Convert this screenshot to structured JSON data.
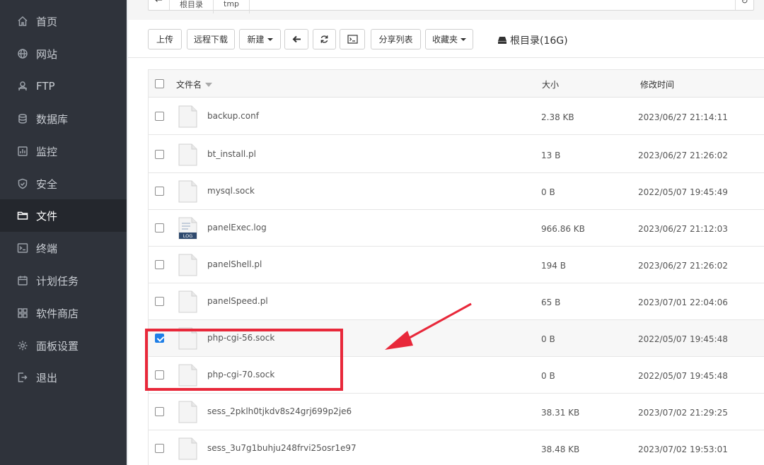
{
  "sidebar": {
    "items": [
      {
        "label": "首页",
        "icon": "home-icon",
        "active": false
      },
      {
        "label": "网站",
        "icon": "globe-icon",
        "active": false
      },
      {
        "label": "FTP",
        "icon": "ftp-icon",
        "active": false
      },
      {
        "label": "数据库",
        "icon": "database-icon",
        "active": false
      },
      {
        "label": "监控",
        "icon": "monitor-icon",
        "active": false
      },
      {
        "label": "安全",
        "icon": "shield-icon",
        "active": false
      },
      {
        "label": "文件",
        "icon": "folder-icon",
        "active": true
      },
      {
        "label": "终端",
        "icon": "terminal-icon",
        "active": false
      },
      {
        "label": "计划任务",
        "icon": "calendar-icon",
        "active": false
      },
      {
        "label": "软件商店",
        "icon": "apps-icon",
        "active": false
      },
      {
        "label": "面板设置",
        "icon": "gear-icon",
        "active": false
      },
      {
        "label": "退出",
        "icon": "logout-icon",
        "active": false
      }
    ]
  },
  "path": {
    "crumbs": [
      "根目录",
      "tmp"
    ]
  },
  "toolbar": {
    "upload": "上传",
    "remote_download": "远程下载",
    "new": "新建",
    "share_list": "分享列表",
    "favorites": "收藏夹",
    "disk": "根目录(16G)"
  },
  "table": {
    "headers": {
      "name": "文件名",
      "size": "大小",
      "time": "修改时间"
    },
    "rows": [
      {
        "name": "backup.conf",
        "size": "2.38 KB",
        "time": "2023/06/27 21:14:11",
        "checked": false,
        "log": false
      },
      {
        "name": "bt_install.pl",
        "size": "13 B",
        "time": "2023/06/27 21:26:02",
        "checked": false,
        "log": false
      },
      {
        "name": "mysql.sock",
        "size": "0 B",
        "time": "2022/05/07 19:45:49",
        "checked": false,
        "log": false
      },
      {
        "name": "panelExec.log",
        "size": "966.86 KB",
        "time": "2023/06/27 21:12:03",
        "checked": false,
        "log": true
      },
      {
        "name": "panelShell.pl",
        "size": "194 B",
        "time": "2023/06/27 21:26:02",
        "checked": false,
        "log": false
      },
      {
        "name": "panelSpeed.pl",
        "size": "65 B",
        "time": "2023/07/01 22:04:06",
        "checked": false,
        "log": false
      },
      {
        "name": "php-cgi-56.sock",
        "size": "0 B",
        "time": "2022/05/07 19:45:48",
        "checked": true,
        "log": false
      },
      {
        "name": "php-cgi-70.sock",
        "size": "0 B",
        "time": "2022/05/07 19:45:48",
        "checked": false,
        "log": false
      },
      {
        "name": "sess_2pklh0tjkdv8s24grj699p2je6",
        "size": "38.31 KB",
        "time": "2023/07/02 21:29:25",
        "checked": false,
        "log": false
      },
      {
        "name": "sess_3u7g1buhju248frvi25osr1e97",
        "size": "38.48 KB",
        "time": "2023/07/02 19:53:01",
        "checked": false,
        "log": false
      }
    ]
  },
  "log_badge": "LOG",
  "colors": {
    "sidebar_bg": "#2f333b",
    "sidebar_active": "#24272d",
    "highlight": "#e8283a",
    "check": "#1e7ee6"
  }
}
